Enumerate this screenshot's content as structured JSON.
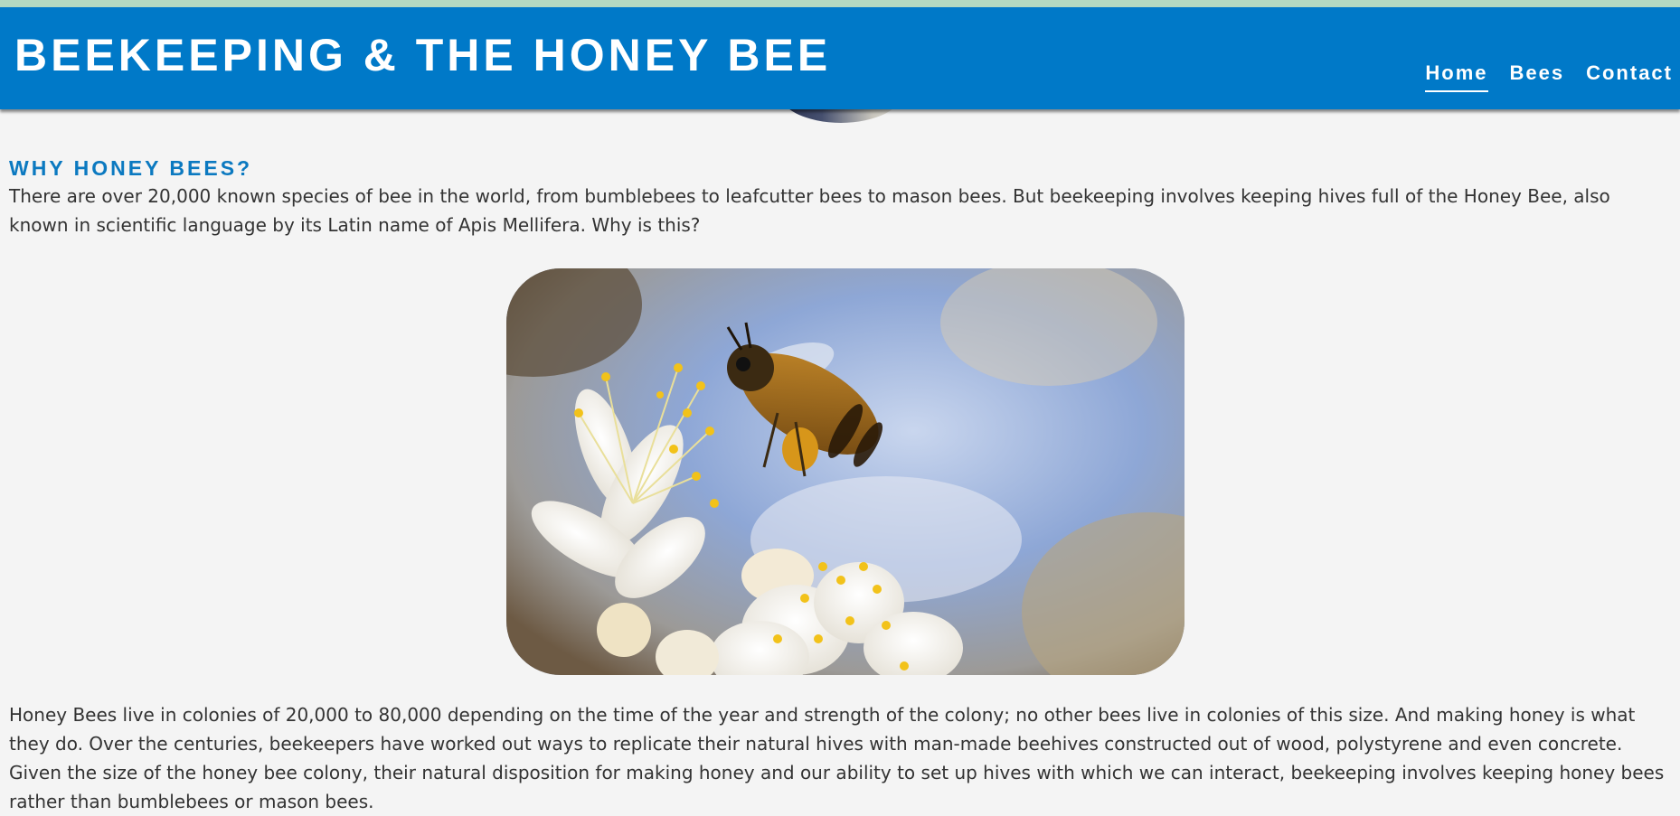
{
  "header": {
    "title": "BEEKEEPING & THE HONEY BEE",
    "nav": [
      {
        "label": "Home",
        "active": true
      },
      {
        "label": "Bees",
        "active": false
      },
      {
        "label": "Contact",
        "active": false
      }
    ]
  },
  "section": {
    "heading": "WHY HONEY BEES?",
    "intro": "There are over 20,000 known species of bee in the world, from bumblebees to leafcutter bees to mason bees. But beekeeping involves keeping hives full of the Honey Bee, also known in scientific language by its Latin name of Apis Mellifera. Why is this?",
    "body": "Honey Bees live in colonies of 20,000 to 80,000 depending on the time of the year and strength of the colony; no other bees live in colonies of this size. And making honey is what they do. Over the centuries, beekeepers have worked out ways to replicate their natural hives with man-made beehives constructed out of wood, polystyrene and even concrete. Given the size of the honey bee colony, their natural disposition for making honey and our ability to set up hives with which we can interact, beekeeping involves keeping honey bees rather than bumblebees or mason bees."
  },
  "colors": {
    "header_bg": "#0079c8",
    "heading_blue": "#0b79c0",
    "page_bg": "#f4f4f4",
    "text": "#333333"
  }
}
